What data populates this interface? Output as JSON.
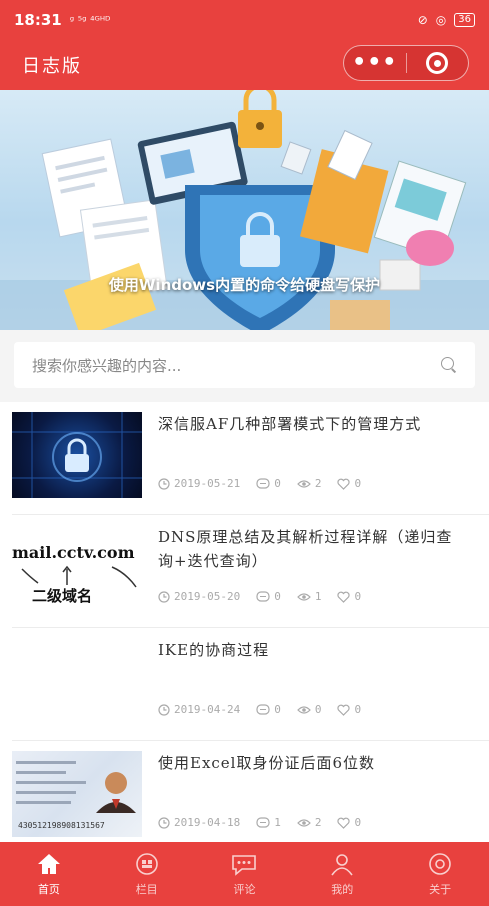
{
  "status_bar": {
    "time": "18:31",
    "network": "ᵍ ⁵ᵍ ⁴ᴳᴴᴰ",
    "battery": "36"
  },
  "nav": {
    "title": "日志版"
  },
  "banner": {
    "caption": "使用Windows内置的命令给硬盘写保护"
  },
  "search": {
    "placeholder": "搜索你感兴趣的内容..."
  },
  "articles": [
    {
      "title": "深信服AF几种部署模式下的管理方式",
      "date": "2019-05-21",
      "comments": "0",
      "views": "2",
      "likes": "0",
      "thumb": "cyber-lock"
    },
    {
      "title": "DNS原理总结及其解析过程详解（递归查询+迭代查询）",
      "date": "2019-05-20",
      "comments": "0",
      "views": "1",
      "likes": "0",
      "thumb": "domain-diagram",
      "thumb_text": "mail.cctv.com",
      "thumb_sub": "二级域名"
    },
    {
      "title": "IKE的协商过程",
      "date": "2019-04-24",
      "comments": "0",
      "views": "0",
      "likes": "0",
      "thumb": "blank"
    },
    {
      "title": "使用Excel取身份证后面6位数",
      "date": "2019-04-18",
      "comments": "1",
      "views": "2",
      "likes": "0",
      "thumb": "id-card",
      "thumb_text": "430512198908131567"
    }
  ],
  "tabs": [
    {
      "label": "首页",
      "icon": "home-icon",
      "active": true
    },
    {
      "label": "栏目",
      "icon": "grid-icon",
      "active": false
    },
    {
      "label": "评论",
      "icon": "comment-icon",
      "active": false
    },
    {
      "label": "我的",
      "icon": "user-icon",
      "active": false
    },
    {
      "label": "关于",
      "icon": "about-icon",
      "active": false
    }
  ],
  "colors": {
    "brand": "#e8413e",
    "meta": "#aaaaaa"
  }
}
